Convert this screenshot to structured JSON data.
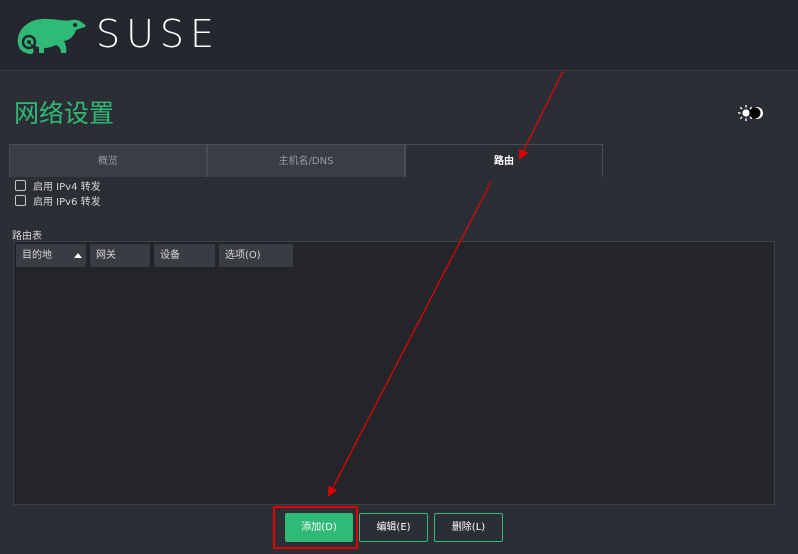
{
  "header": {
    "brand": "SUSE"
  },
  "page": {
    "title": "网络设置"
  },
  "tabs": [
    {
      "label": "概览",
      "active": false
    },
    {
      "label": "主机名/DNS",
      "active": false
    },
    {
      "label": "路由",
      "active": true
    }
  ],
  "forwarding": {
    "ipv4_label": "启用 IPv4 转发",
    "ipv4_checked": false,
    "ipv6_label": "启用 IPv6 转发",
    "ipv6_checked": false
  },
  "routes": {
    "section_label": "路由表",
    "columns": [
      "目的地",
      "网关",
      "设备",
      "选项(O)"
    ],
    "sorted_column": "目的地",
    "sort_direction": "ascending",
    "rows": []
  },
  "buttons": {
    "add": "添加(D)",
    "edit": "编辑(E)",
    "delete": "删除(L)"
  },
  "colors": {
    "brand_green": "#30ba78",
    "annotation_red": "#e00000",
    "background": "#2c2e35"
  },
  "icons": {
    "logo": "chameleon-logo-icon",
    "theme": "sun-moon-toggle-icon",
    "sort": "sort-ascending-icon"
  }
}
